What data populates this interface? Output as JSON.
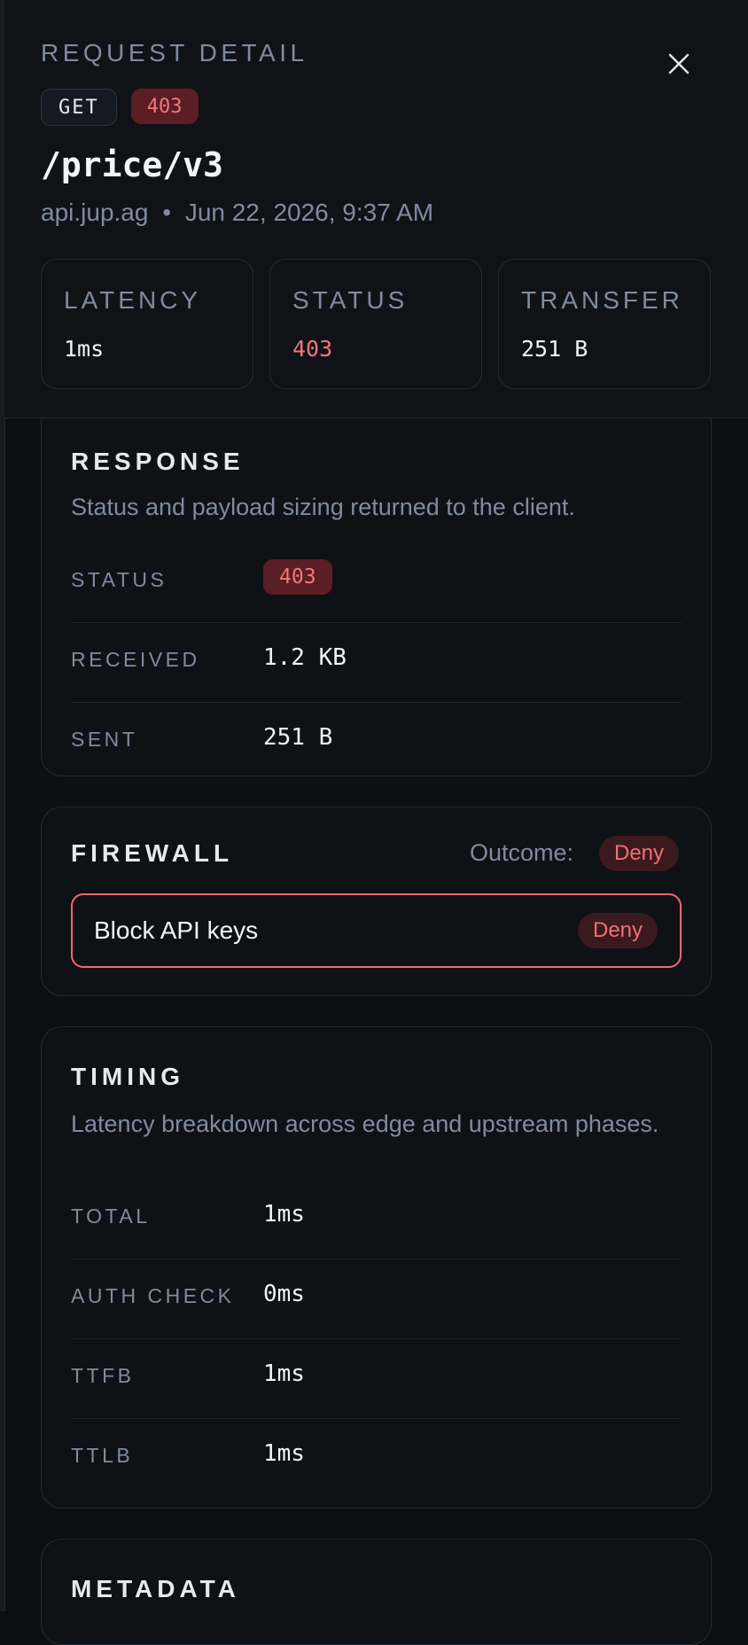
{
  "panel": {
    "eyebrow": "REQUEST DETAIL",
    "method": "GET",
    "status_code": "403",
    "path": "/price/v3",
    "host": "api.jup.ag",
    "separator": "•",
    "timestamp": "Jun 22, 2026, 9:37 AM",
    "close_icon": "close-icon"
  },
  "stats": {
    "latency": {
      "label": "LATENCY",
      "value": "1ms"
    },
    "status": {
      "label": "STATUS",
      "value": "403"
    },
    "transfer": {
      "label": "TRANSFER",
      "value": "251 B"
    }
  },
  "response": {
    "title": "RESPONSE",
    "subtitle": "Status and payload sizing returned to the client.",
    "rows": [
      {
        "label": "STATUS",
        "value": "403"
      },
      {
        "label": "RECEIVED",
        "value": "1.2 KB"
      },
      {
        "label": "SENT",
        "value": "251 B"
      }
    ]
  },
  "firewall": {
    "title": "FIREWALL",
    "outcome_label": "Outcome:",
    "outcome": "Deny",
    "rule": {
      "name": "Block API keys",
      "action": "Deny"
    }
  },
  "timing": {
    "title": "TIMING",
    "subtitle": "Latency breakdown across edge and upstream phases.",
    "rows": [
      {
        "label": "TOTAL",
        "value": "1ms"
      },
      {
        "label": "AUTH CHECK",
        "value": "0ms"
      },
      {
        "label": "TTFB",
        "value": "1ms"
      },
      {
        "label": "TTLB",
        "value": "1ms"
      }
    ]
  },
  "metadata": {
    "title": "METADATA"
  },
  "colors": {
    "background": "#0c0f14",
    "error": "#f3767b",
    "error_bg": "#5a1e24",
    "muted": "#7f8ba0"
  }
}
